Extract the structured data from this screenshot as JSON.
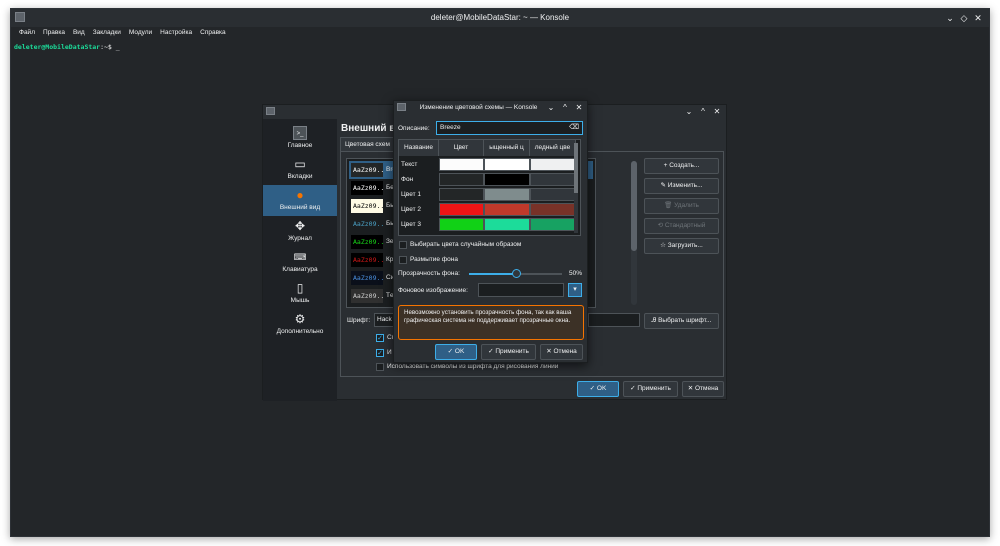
{
  "konsole": {
    "title": "deleter@MobileDataStar: ~ — Konsole",
    "window_buttons": [
      "⌄",
      "◇",
      "✕"
    ],
    "menu": [
      "Файл",
      "Правка",
      "Вид",
      "Закладки",
      "Модули",
      "Настройка",
      "Справка"
    ],
    "prompt_user": "deleter@MobileDataStar",
    "prompt_rest": ":~$ ",
    "cursor": "_"
  },
  "settings": {
    "window_buttons": [
      "⌄",
      "^",
      "✕"
    ],
    "sidebar": [
      {
        "label": "Главное",
        "icon": "terminal-icon"
      },
      {
        "label": "Вкладки",
        "icon": "tabs-icon"
      },
      {
        "label": "Внешний вид",
        "icon": "color-palette-icon"
      },
      {
        "label": "Журнал",
        "icon": "scroll-icon"
      },
      {
        "label": "Клавиатура",
        "icon": "keyboard-icon"
      },
      {
        "label": "Мышь",
        "icon": "mouse-icon"
      },
      {
        "label": "Дополнительно",
        "icon": "gear-icon"
      }
    ],
    "heading": "Внешний в",
    "tab": "Цветовая схем",
    "schemes": [
      {
        "preview": "AaZz09...",
        "name": "Bre",
        "fg": "#fcfcfc",
        "bg": "#232627"
      },
      {
        "preview": "AaZz09...",
        "name": "Бе",
        "fg": "#ffffff",
        "bg": "#000000"
      },
      {
        "preview": "AaZz09...",
        "name": "Бы",
        "fg": "#000000",
        "bg": "#fffbe5"
      },
      {
        "preview": "AaZz09...",
        "name": "Бы",
        "fg": "#4aa0c4",
        "bg": "#1b1e20"
      },
      {
        "preview": "AaZz09...",
        "name": "Зе",
        "fg": "#18d818",
        "bg": "#000000"
      },
      {
        "preview": "AaZz09...",
        "name": "Кр",
        "fg": "#d01818",
        "bg": "#000000"
      },
      {
        "preview": "AaZz09...",
        "name": "Си",
        "fg": "#4a90e0",
        "bg": "#0a0f1a"
      },
      {
        "preview": "AaZz09...",
        "name": "Тe",
        "fg": "#d0d0d0",
        "bg": "#303030"
      }
    ],
    "buttons": {
      "create": "+ Создать...",
      "edit": "✎ Изменить...",
      "delete": "🗑 Удалить",
      "default": "⟲ Стандартный",
      "load": "☆ Загрузить...",
      "choose_font": "Ꭿ Выбрать шрифт...",
      "ok": "✓ OK",
      "apply": "✓ Применить",
      "cancel": "✕ Отмена"
    },
    "font_label": "Шрифт:",
    "font_value": "Hack",
    "checks": [
      {
        "label": "Сг",
        "checked": true
      },
      {
        "label": "И",
        "checked": true
      },
      {
        "label": "Использовать символы из шрифта для рисования линии",
        "checked": false
      }
    ]
  },
  "color_dialog": {
    "title": "Изменение цветовой схемы — Konsole",
    "window_buttons": [
      "⌄",
      "^",
      "✕"
    ],
    "desc_label": "Описание:",
    "desc_value": "Breeze",
    "columns": [
      "Название",
      "Цвет",
      "ыщенный ц",
      "ледный цве"
    ],
    "rows": [
      {
        "name": "Текст",
        "colors": [
          "#fcfcfc",
          "#ffffff",
          "#eff0f1"
        ]
      },
      {
        "name": "Фон",
        "colors": [
          "#232627",
          "#000000",
          "#31363b"
        ]
      },
      {
        "name": "Цвет 1",
        "colors": [
          "#232627",
          "#7f8c8d",
          "#31363b"
        ]
      },
      {
        "name": "Цвет 2",
        "colors": [
          "#ed1515",
          "#c0392b",
          "#783228"
        ]
      },
      {
        "name": "Цвет 3",
        "colors": [
          "#11d116",
          "#1cdc9a",
          "#17a262"
        ]
      }
    ],
    "random_colors_label": "Выбирать цвета случайным образом",
    "blur_label": "Размытие фона",
    "transparency_label": "Прозрачность фона:",
    "transparency_value": "50%",
    "transparency": 0.5,
    "bg_image_label": "Фоновое изображение:",
    "warning": "Невозможно установить прозрачность фона, так как ваша графическая система не поддерживает прозрачные окна.",
    "ok": "✓ OK",
    "apply": "✓ Применить",
    "cancel": "✕ Отмена"
  }
}
